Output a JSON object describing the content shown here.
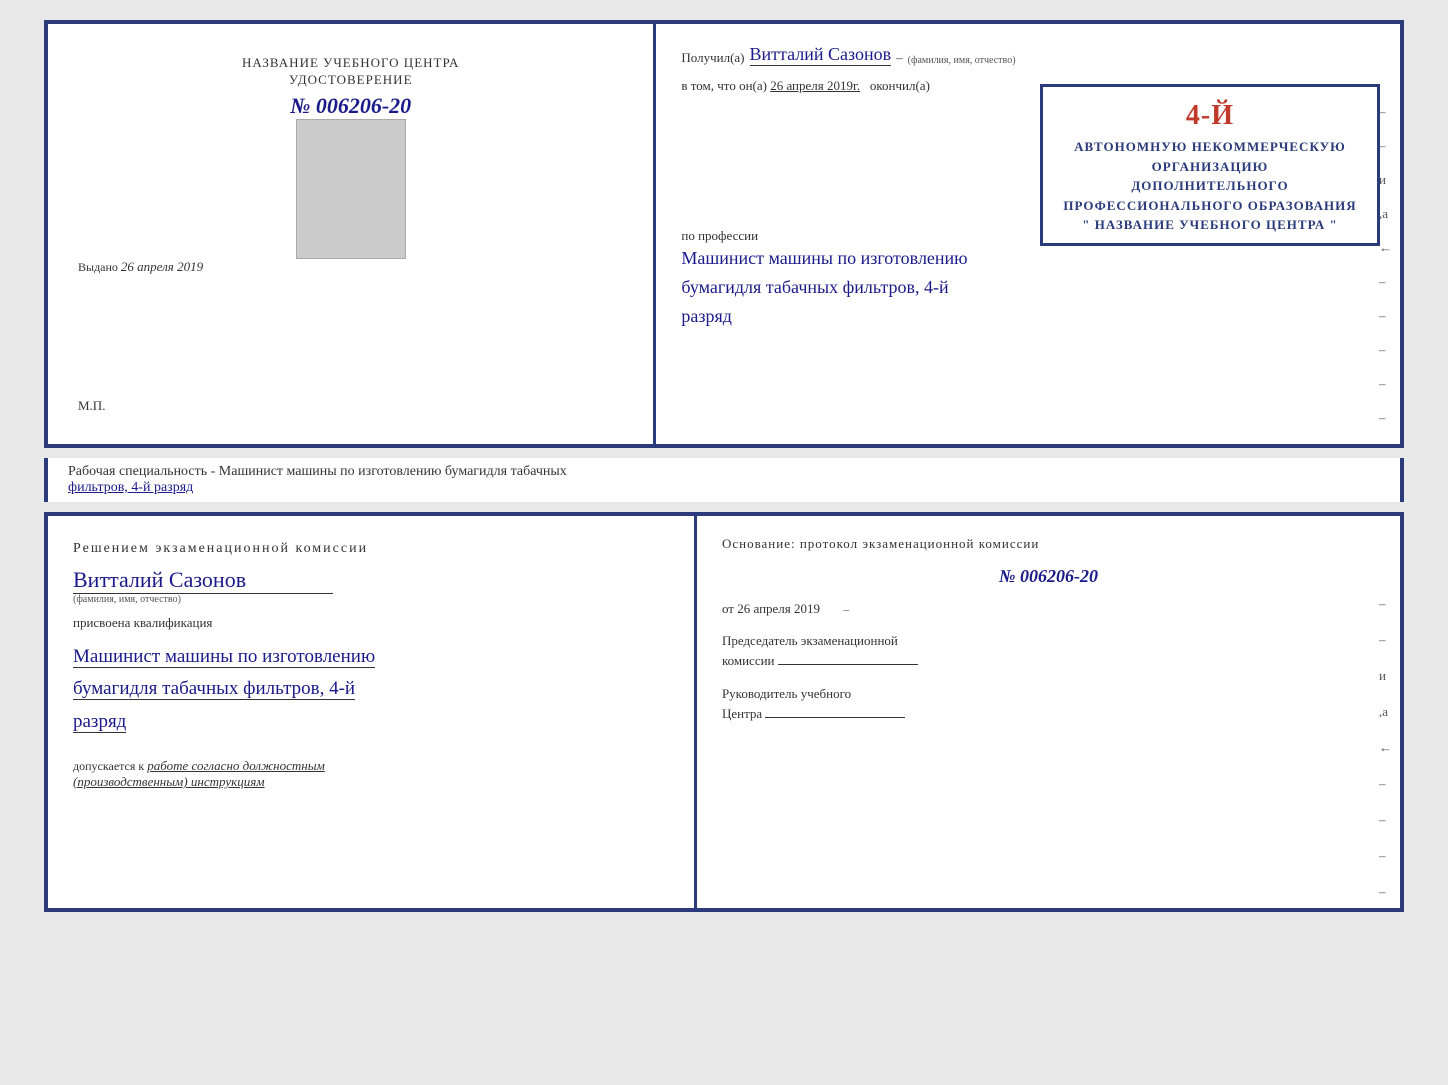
{
  "top_left": {
    "center_title": "НАЗВАНИЕ УЧЕБНОГО ЦЕНТРА",
    "cert_label": "УДОСТОВЕРЕНИЕ",
    "cert_number": "№ 006206-20",
    "issued_label": "Выдано",
    "issued_date": "26 апреля 2019",
    "mp_label": "М.П."
  },
  "top_right": {
    "received_prefix": "Получил(а)",
    "recipient_name": "Витталий Сазонов",
    "name_note": "(фамилия, имя, отчество)",
    "vtom_prefix": "в том, что он(а)",
    "completed_date": "26 апреля 2019г.",
    "completed_suffix": "окончил(а)",
    "stamp_line1": "4-й",
    "stamp_line2": "АВТОНОМНУЮ НЕКОММЕРЧЕСКУЮ ОРГАНИЗАЦИЮ",
    "stamp_line3": "ДОПОЛНИТЕЛЬНОГО ПРОФЕССИОНАЛЬНОГО ОБРАЗОВАНИЯ",
    "stamp_line4": "\" НАЗВАНИЕ УЧЕБНОГО ЦЕНТРА \"",
    "profession_prefix": "по профессии",
    "profession_line1": "Машинист машины по изготовлению",
    "profession_line2": "бумагидля табачных фильтров, 4-й",
    "profession_line3": "разряд"
  },
  "speciality_banner": {
    "prefix": "Рабочая специальность - Машинист машины по изготовлению бумагидля табачных",
    "underline_part": "фильтров, 4-й разряд"
  },
  "bottom_left": {
    "komissia_title": "Решением  экзаменационной  комиссии",
    "person_name": "Витталий Сазонов",
    "name_note": "(фамилия, имя, отчество)",
    "assigned_label": "присвоена квалификация",
    "profession_line1": "Машинист машины по изготовлению",
    "profession_line2": "бумагидля табачных фильтров, 4-й",
    "profession_line3": "разряд",
    "admitted_prefix": "допускается к",
    "admitted_text": "работе согласно должностным",
    "admitted_text2": "(производственным) инструкциям"
  },
  "bottom_right": {
    "osnov_label": "Основание: протокол экзаменационной  комиссии",
    "protocol_number": "№  006206-20",
    "from_prefix": "от",
    "from_date": "26 апреля 2019",
    "chairman_label": "Председатель экзаменационной",
    "chairman_label2": "комиссии",
    "director_label": "Руководитель учебного",
    "director_label2": "Центра"
  },
  "dashes": [
    "-",
    "-",
    "–",
    "и",
    ",а",
    "←",
    "-",
    "-",
    "-",
    "-"
  ]
}
